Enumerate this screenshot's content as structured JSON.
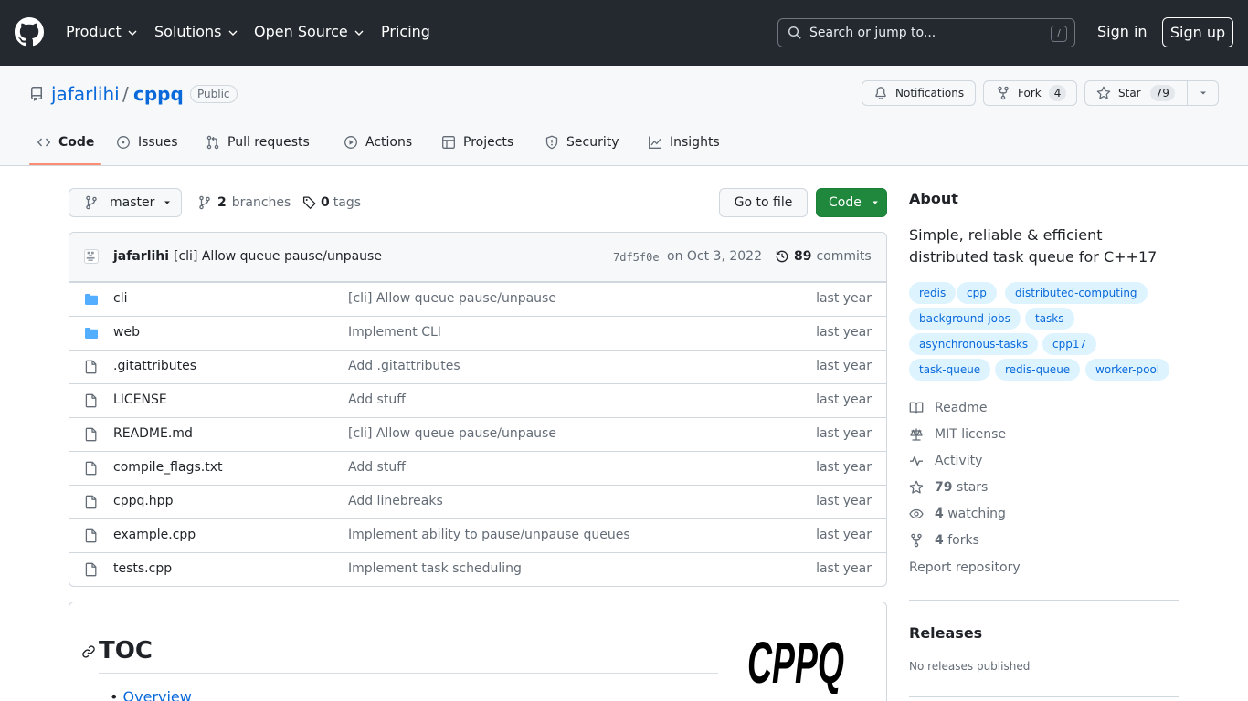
{
  "colors": {
    "header_bg": "#24292f",
    "link": "#0969da",
    "green": "#1f883d",
    "tab_underline": "#fd8c73",
    "topic_bg": "#ddf4ff",
    "folder": "#54aeff"
  },
  "header": {
    "nav": [
      {
        "label": "Product",
        "dropdown": true
      },
      {
        "label": "Solutions",
        "dropdown": true
      },
      {
        "label": "Open Source",
        "dropdown": true
      },
      {
        "label": "Pricing",
        "dropdown": false
      }
    ],
    "search_placeholder": "Search or jump to...",
    "search_shortcut": "/",
    "signin": "Sign in",
    "signup": "Sign up"
  },
  "repo": {
    "owner": "jafarlihi",
    "separator": "/",
    "name": "cppq",
    "visibility": "Public",
    "notifications_label": "Notifications",
    "fork_label": "Fork",
    "fork_count": "4",
    "star_label": "Star",
    "star_count": "79"
  },
  "tabs": [
    {
      "label": "Code",
      "icon": "code-icon",
      "active": true
    },
    {
      "label": "Issues",
      "icon": "issue-opened-icon"
    },
    {
      "label": "Pull requests",
      "icon": "git-pull-request-icon"
    },
    {
      "label": "Actions",
      "icon": "play-icon"
    },
    {
      "label": "Projects",
      "icon": "table-icon"
    },
    {
      "label": "Security",
      "icon": "shield-icon"
    },
    {
      "label": "Insights",
      "icon": "graph-icon"
    }
  ],
  "branchbar": {
    "branch": "master",
    "branches_count": "2",
    "branches_label": "branches",
    "tags_count": "0",
    "tags_label": "tags",
    "goto_file": "Go to file",
    "code_button": "Code"
  },
  "commit": {
    "author": "jafarlihi",
    "message": "[cli] Allow queue pause/unpause",
    "sha": "7df5f0e",
    "date": "on Oct 3, 2022",
    "commits_count": "89",
    "commits_label": "commits"
  },
  "files": [
    {
      "name": "cli",
      "type": "dir",
      "message": "[cli] Allow queue pause/unpause",
      "age": "last year"
    },
    {
      "name": "web",
      "type": "dir",
      "message": "Implement CLI",
      "age": "last year"
    },
    {
      "name": ".gitattributes",
      "type": "file",
      "message": "Add .gitattributes",
      "age": "last year"
    },
    {
      "name": "LICENSE",
      "type": "file",
      "message": "Add stuff",
      "age": "last year"
    },
    {
      "name": "README.md",
      "type": "file",
      "message": "[cli] Allow queue pause/unpause",
      "age": "last year"
    },
    {
      "name": "compile_flags.txt",
      "type": "file",
      "message": "Add stuff",
      "age": "last year"
    },
    {
      "name": "cppq.hpp",
      "type": "file",
      "message": "Add linebreaks",
      "age": "last year"
    },
    {
      "name": "example.cpp",
      "type": "file",
      "message": "Implement ability to pause/unpause queues",
      "age": "last year"
    },
    {
      "name": "tests.cpp",
      "type": "file",
      "message": "Implement task scheduling",
      "age": "last year"
    }
  ],
  "readme": {
    "heading": "TOC",
    "toc_first": "Overview",
    "logo_text": "CPPQ"
  },
  "about": {
    "heading": "About",
    "description": "Simple, reliable & efficient distributed task queue for C++17",
    "topics": [
      "redis",
      "cpp",
      "distributed-computing",
      "background-jobs",
      "tasks",
      "asynchronous-tasks",
      "cpp17",
      "task-queue",
      "redis-queue",
      "worker-pool"
    ],
    "readme": "Readme",
    "license": "MIT license",
    "activity": "Activity",
    "stars_count": "79",
    "stars_label": "stars",
    "watching_count": "4",
    "watching_label": "watching",
    "forks_count": "4",
    "forks_label": "forks",
    "report": "Report repository"
  },
  "releases": {
    "heading": "Releases",
    "none": "No releases published"
  }
}
